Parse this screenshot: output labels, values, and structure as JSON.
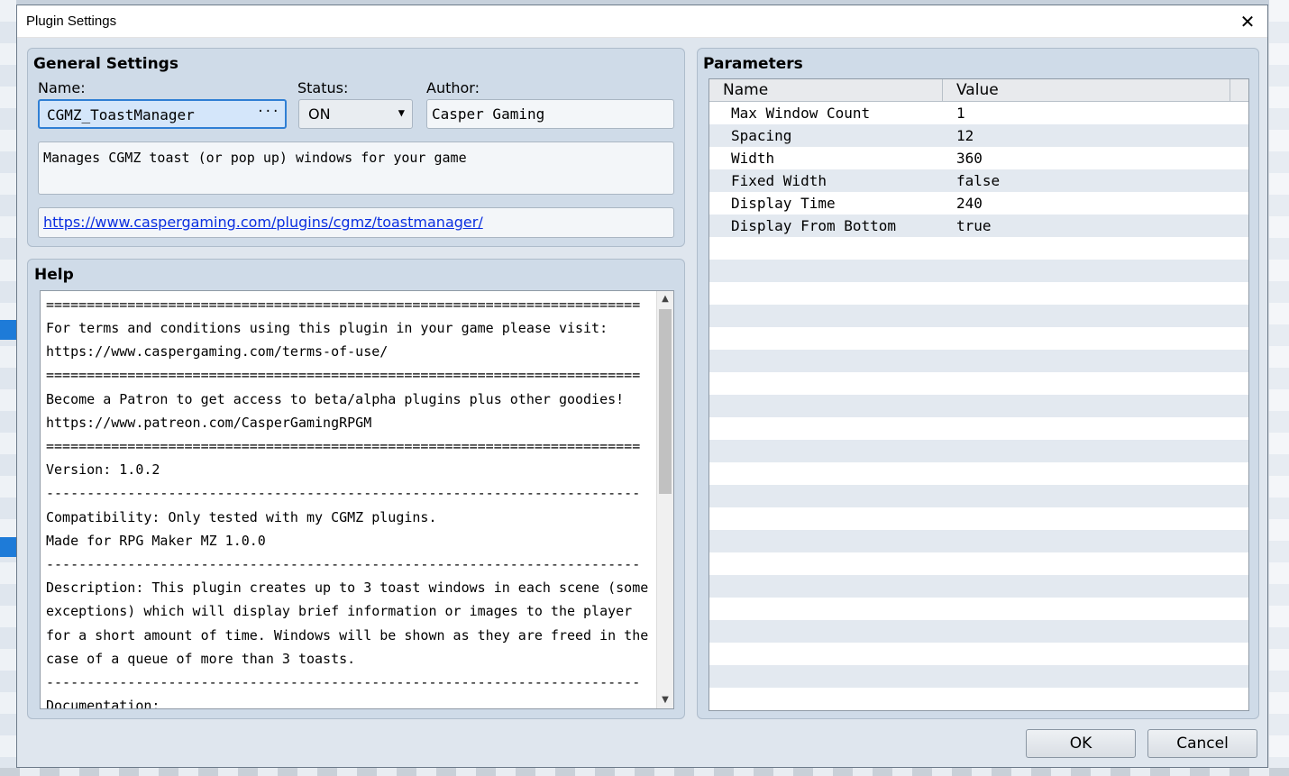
{
  "dialog": {
    "title": "Plugin Settings",
    "close_glyph": "✕"
  },
  "general": {
    "title": "General Settings",
    "name_label": "Name:",
    "name_value": "CGMZ_ToastManager",
    "name_button": "···",
    "status_label": "Status:",
    "status_value": "ON",
    "author_label": "Author:",
    "author_value": "Casper Gaming",
    "description": "Manages CGMZ toast (or pop up) windows for your game",
    "url": "https://www.caspergaming.com/plugins/cgmz/toastmanager/"
  },
  "help": {
    "title": "Help",
    "lines": [
      "=========================================================================",
      "For terms and conditions using this plugin in your game please visit:",
      "https://www.caspergaming.com/terms-of-use/",
      "=========================================================================",
      "Become a Patron to get access to beta/alpha plugins plus other goodies!",
      "https://www.patreon.com/CasperGamingRPGM",
      "=========================================================================",
      "Version: 1.0.2",
      "-------------------------------------------------------------------------",
      "Compatibility: Only tested with my CGMZ plugins.",
      "Made for RPG Maker MZ 1.0.0",
      "-------------------------------------------------------------------------",
      "Description: This plugin creates up to 3 toast windows in each scene (some",
      "exceptions) which will display brief information or images to the player",
      "for a short amount of time. Windows will be shown as they are freed in the",
      "case of a queue of more than 3 toasts.",
      "-------------------------------------------------------------------------",
      "Documentation:"
    ],
    "scroll_up": "▲",
    "scroll_down": "▼"
  },
  "parameters": {
    "title": "Parameters",
    "columns": [
      "Name",
      "Value"
    ],
    "rows": [
      [
        "Max Window Count",
        "1"
      ],
      [
        "Spacing",
        "12"
      ],
      [
        "Width",
        "360"
      ],
      [
        "Fixed Width",
        "false"
      ],
      [
        "Display Time",
        "240"
      ],
      [
        "Display From Bottom",
        "true"
      ]
    ]
  },
  "buttons": {
    "ok": "OK",
    "cancel": "Cancel"
  }
}
